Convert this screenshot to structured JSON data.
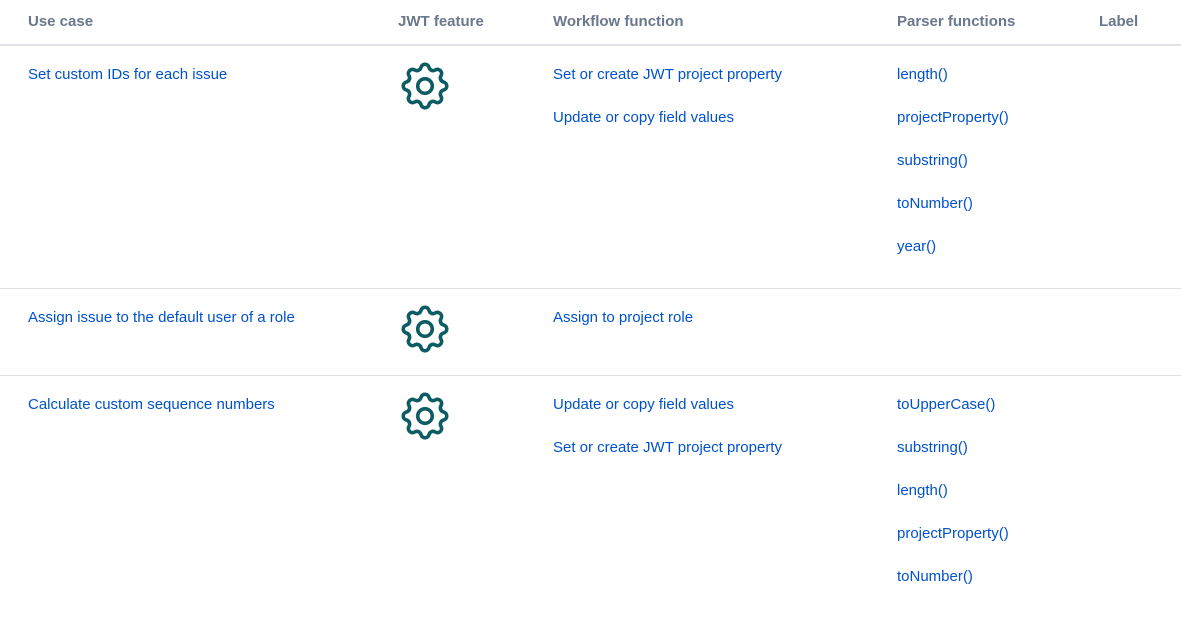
{
  "headers": {
    "use_case": "Use case",
    "jwt_feature": "JWT feature",
    "workflow_function": "Workflow function",
    "parser_functions": "Parser functions",
    "label": "Label"
  },
  "rows": [
    {
      "use_case": "Set custom IDs for each issue",
      "feature_icon": "gear-icon",
      "workflow_functions": [
        "Set or create JWT project property",
        "Update or copy field values"
      ],
      "parser_functions": [
        "length()",
        "projectProperty()",
        "substring()",
        "toNumber()",
        "year()"
      ]
    },
    {
      "use_case": "Assign issue to the default user of a role",
      "feature_icon": "gear-icon",
      "workflow_functions": [
        "Assign to project role"
      ],
      "parser_functions": []
    },
    {
      "use_case": "Calculate custom sequence numbers",
      "feature_icon": "gear-icon",
      "workflow_functions": [
        "Update or copy field values",
        "Set or create JWT project property"
      ],
      "parser_functions": [
        "toUpperCase()",
        "substring()",
        "length()",
        "projectProperty()",
        "toNumber()"
      ]
    }
  ],
  "colors": {
    "link": "#0052cc",
    "header_text": "#6b778c",
    "gear": "#0e5c63",
    "divider": "#dfe1e6"
  }
}
